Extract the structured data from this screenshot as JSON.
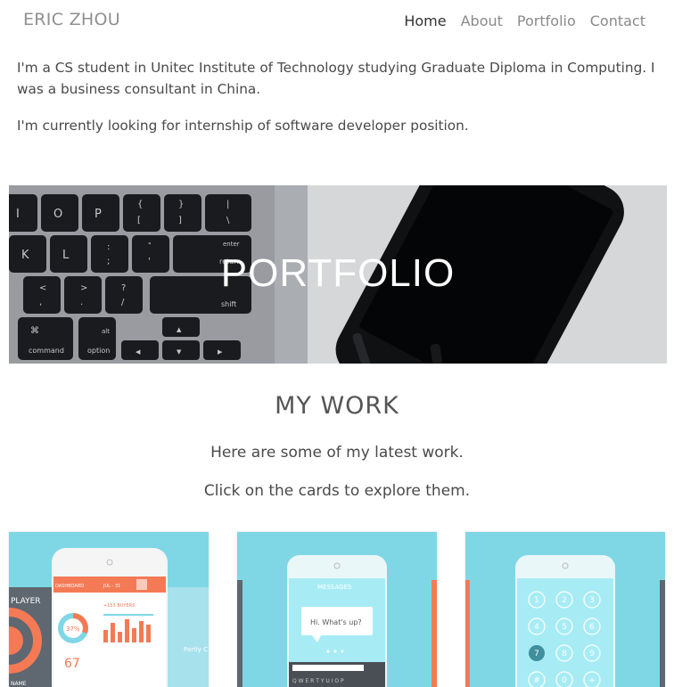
{
  "nav": {
    "brand": "ERIC ZHOU",
    "items": [
      "Home",
      "About",
      "Portfolio",
      "Contact"
    ]
  },
  "intro": {
    "p1": "I'm a CS student in Unitec Institute of Technology studying Graduate Diploma in Computing. I was a business consultant in China.",
    "p2": "I'm currently looking for internship of software developer position."
  },
  "hero": {
    "title": "PORTFOLIO",
    "keys_row1": [
      "I",
      "O",
      "P",
      "{",
      "}",
      "|"
    ],
    "keys_row1_sub": [
      "",
      "",
      "",
      "[",
      "]",
      "\\"
    ],
    "keys_row2": [
      "K",
      "L",
      ":",
      "\"",
      "enter"
    ],
    "keys_row2_sub": [
      "",
      "",
      ";",
      "'",
      "return"
    ],
    "keys_row3": [
      "<",
      ">",
      "?",
      "shift"
    ],
    "keys_row3_sub": [
      ",",
      ".",
      "/",
      ""
    ],
    "keys_row4": [
      "⌘",
      "alt",
      "◀",
      "▲",
      "▶"
    ],
    "keys_row4_sub": [
      "command",
      "option",
      "",
      "▼",
      ""
    ]
  },
  "work": {
    "title": "MY WORK",
    "line1": "Here are some of my latest work.",
    "line2": "Click on the cards to explore them."
  },
  "cards": [
    {
      "left_label": "PLAYER",
      "left_sub": "NAME",
      "header": "DASHBOARD",
      "header_date": "JUL - 31",
      "percent": "37%",
      "buyers": "+153 BUYERS",
      "big_number": "67",
      "side_label": "Partly C"
    },
    {
      "header": "MESSAGES",
      "bubble": "Hi. What's up?",
      "keyboard_row": "Q W E R T Y U I O P"
    },
    {
      "keys": [
        "1",
        "2",
        "3",
        "4",
        "5",
        "6",
        "7",
        "8",
        "9",
        "#",
        "0",
        "+"
      ]
    }
  ],
  "colors": {
    "accent_cyan": "#7fd7e6",
    "phone_cyan": "#a7ecf5",
    "orange": "#f47a55",
    "dark": "#5f6770"
  }
}
